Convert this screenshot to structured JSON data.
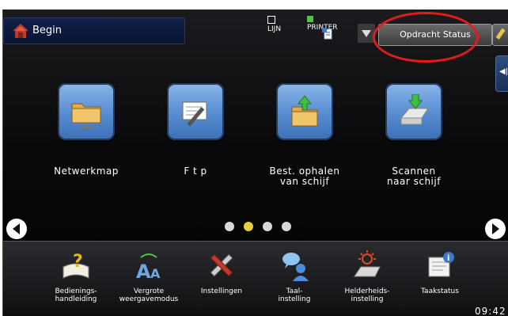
{
  "header": {
    "home_label": "Begin",
    "lijn_label": "LIJN",
    "printer_label": "PRINTER",
    "job_status_label": "Opdracht Status"
  },
  "tiles": [
    {
      "label": "Netwerkmap",
      "icon": "network-folder-icon"
    },
    {
      "label": "F t p",
      "icon": "ftp-icon"
    },
    {
      "label": "Best. ophalen\nvan schijf",
      "icon": "retrieve-from-disk-icon"
    },
    {
      "label": "Scannen\nnaar schijf",
      "icon": "scan-to-disk-icon"
    }
  ],
  "carousel": {
    "pages": 4,
    "active_page": 2
  },
  "bottom_bar": [
    {
      "label": "Bedienings-\nhandleiding",
      "icon": "manual-icon"
    },
    {
      "label": "Vergrote\nweergavemodus",
      "icon": "zoom-text-icon"
    },
    {
      "label": "Instellingen",
      "icon": "settings-tools-icon"
    },
    {
      "label": "Taal-\ninstelling",
      "icon": "language-icon"
    },
    {
      "label": "Helderheids-\ninstelling",
      "icon": "brightness-icon"
    },
    {
      "label": "Taakstatus",
      "icon": "job-status-icon"
    }
  ],
  "clock": "09:42",
  "colors": {
    "highlight_circle": "#e21b1b",
    "active_dot": "#e6cf3e",
    "tile_blue": "#5a8fd3"
  }
}
